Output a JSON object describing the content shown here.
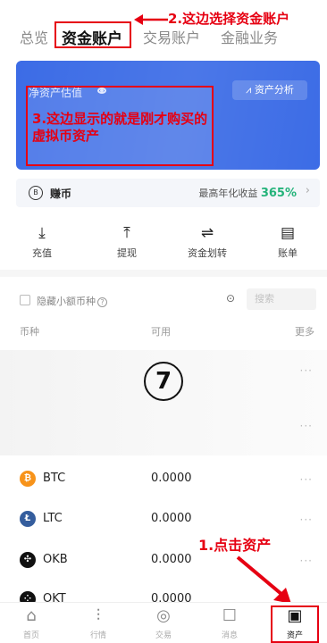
{
  "tabs": [
    {
      "label": "总览",
      "active": false
    },
    {
      "label": "资金账户",
      "active": true
    },
    {
      "label": "交易账户",
      "active": false
    },
    {
      "label": "金融业务",
      "active": false
    }
  ],
  "annotations": {
    "select_account": "2.这边选择资金账户",
    "asset_display": "3.这边显示的就是刚才购买的虚拟币资产",
    "tap_asset": "1.点击资产",
    "step_number": "7"
  },
  "card": {
    "net_asset_label": "净资产估值",
    "analysis_button": "资产分析",
    "background_color": "#3c6ce6"
  },
  "earn": {
    "icon_text": "B",
    "label": "赚币",
    "apy_label": "最高年化收益",
    "apy_value": "365%",
    "chevron": "›"
  },
  "actions": [
    {
      "label": "充值",
      "icon": "download-icon",
      "glyph": "⤓"
    },
    {
      "label": "提现",
      "icon": "upload-icon",
      "glyph": "⤒"
    },
    {
      "label": "资金划转",
      "icon": "transfer-icon",
      "glyph": "⇌"
    },
    {
      "label": "账单",
      "icon": "bill-icon",
      "glyph": "▤"
    }
  ],
  "filter": {
    "hide_small_label": "隐藏小额币种",
    "help_glyph": "?",
    "search_placeholder": "搜索"
  },
  "table": {
    "headers": {
      "coin": "币种",
      "available": "可用",
      "more": "更多"
    },
    "more_glyph": "···",
    "rows": [
      {
        "coin": "BTC",
        "value": "0.0000",
        "icon_glyph": "₿",
        "color": "#f7931a"
      },
      {
        "coin": "LTC",
        "value": "0.0000",
        "icon_glyph": "Ł",
        "color": "#345d9d"
      },
      {
        "coin": "OKB",
        "value": "0.0000",
        "icon_glyph": "✣",
        "color": "#111111"
      },
      {
        "coin": "OKT",
        "value": "0.0000",
        "icon_glyph": "⁘",
        "color": "#111111"
      }
    ]
  },
  "bottom_nav": [
    {
      "label": "首页",
      "icon": "home-icon",
      "glyph": "⌂",
      "active": false
    },
    {
      "label": "行情",
      "icon": "market-icon",
      "glyph": "⫶",
      "active": false
    },
    {
      "label": "交易",
      "icon": "trade-icon",
      "glyph": "◎",
      "active": false
    },
    {
      "label": "消息",
      "icon": "message-icon",
      "glyph": "☐",
      "active": false
    },
    {
      "label": "资产",
      "icon": "wallet-icon",
      "glyph": "▣",
      "active": true
    }
  ],
  "colors": {
    "accent_red": "#e60012",
    "positive_green": "#24b37a"
  }
}
